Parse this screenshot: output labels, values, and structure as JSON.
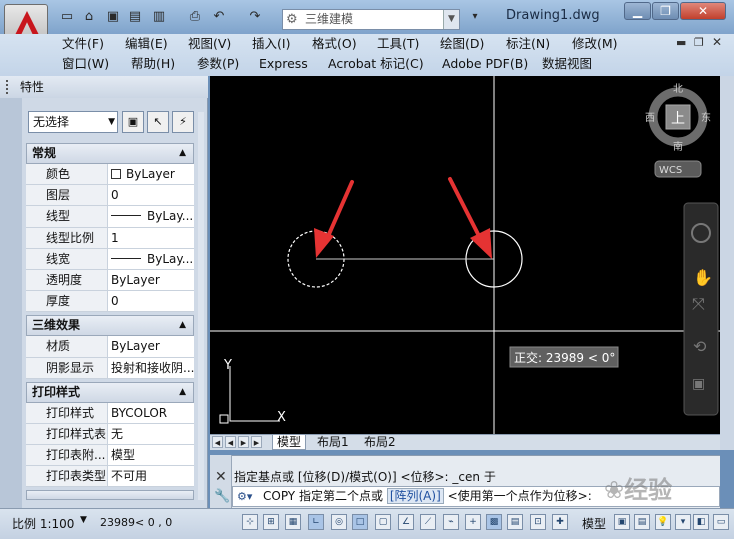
{
  "title_bar": {
    "workspace": "三维建模",
    "document_title": "Drawing1.dwg",
    "icons": [
      "new-icon",
      "open-icon",
      "save-icon",
      "saveas-icon",
      "plot-icon",
      "print-icon",
      "undo-icon",
      "redo-icon",
      "gear-icon",
      "chevron-down-icon",
      "minimize-icon",
      "restore-icon",
      "close-icon"
    ]
  },
  "menubar": {
    "row1": [
      "文件(F)",
      "编辑(E)",
      "视图(V)",
      "插入(I)",
      "格式(O)",
      "工具(T)",
      "绘图(D)",
      "标注(N)",
      "修改(M)"
    ],
    "row2": [
      "窗口(W)",
      "帮助(H)",
      "参数(P)",
      "Express",
      "Acrobat 标记(C)",
      "Adobe PDF(B)",
      "数据视图"
    ]
  },
  "palette": {
    "title": "特性",
    "selection": "无选择",
    "sections": [
      {
        "title": "常规",
        "rows": [
          {
            "key": "颜色",
            "value": "ByLayer",
            "swatch": true
          },
          {
            "key": "图层",
            "value": "0"
          },
          {
            "key": "线型",
            "value": "ByLay...",
            "line": true
          },
          {
            "key": "线型比例",
            "value": "1"
          },
          {
            "key": "线宽",
            "value": "ByLay...",
            "line": true
          },
          {
            "key": "透明度",
            "value": "ByLayer"
          },
          {
            "key": "厚度",
            "value": "0"
          }
        ]
      },
      {
        "title": "三维效果",
        "rows": [
          {
            "key": "材质",
            "value": "ByLayer"
          },
          {
            "key": "阴影显示",
            "value": "投射和接收阴..."
          }
        ]
      },
      {
        "title": "打印样式",
        "rows": [
          {
            "key": "打印样式",
            "value": "BYCOLOR"
          },
          {
            "key": "打印样式表",
            "value": "无"
          },
          {
            "key": "打印表附...",
            "value": "模型"
          },
          {
            "key": "打印表类型",
            "value": "不可用"
          }
        ]
      }
    ]
  },
  "viewport": {
    "tooltip": "正交: 23989 < 0°",
    "viewcube": {
      "north": "北",
      "south": "南",
      "east": "东",
      "west": "西",
      "face": "上",
      "wcs": "WCS"
    },
    "ucs": {
      "x": "X",
      "y": "Y"
    },
    "colors": {
      "background": "#000000",
      "geometry": "#ffffff",
      "arrow": "#e53333"
    }
  },
  "layout_tabs": [
    "模型",
    "布局1",
    "布局2"
  ],
  "command": {
    "history": "指定基点或 [位移(D)/模式(O)] <位移>: _cen 于",
    "prompt_cmd": "COPY",
    "prompt_text": "指定第二个点或",
    "prompt_option": "[阵列(A)]",
    "prompt_rest": "<使用第一个点作为位移>:"
  },
  "status": {
    "scale": "比例 1:100",
    "coordinates": "23989< 0      ,      0",
    "model": "模型"
  },
  "watermark": "经验"
}
